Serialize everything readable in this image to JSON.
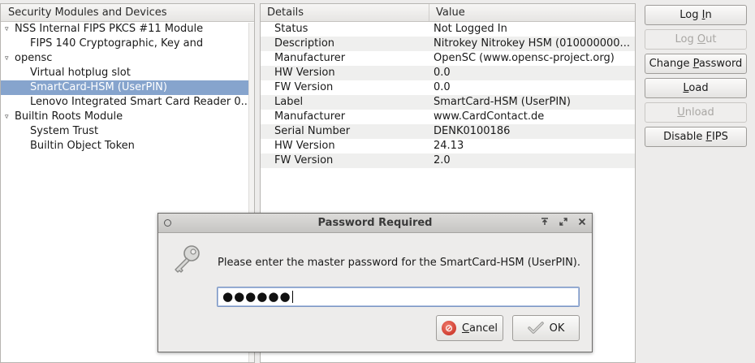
{
  "tree": {
    "header": "Security Modules and Devices",
    "items": [
      {
        "label": "NSS Internal FIPS PKCS #11 Module",
        "expander": "▿"
      },
      {
        "label": "FIPS 140 Cryptographic, Key and"
      },
      {
        "label": "opensc",
        "expander": "▿"
      },
      {
        "label": "Virtual hotplug slot"
      },
      {
        "label": "SmartCard-HSM (UserPIN)"
      },
      {
        "label": "Lenovo Integrated Smart Card Reader 0..."
      },
      {
        "label": "Builtin Roots Module",
        "expander": "▿"
      },
      {
        "label": "System Trust"
      },
      {
        "label": "Builtin Object Token"
      }
    ]
  },
  "details": {
    "col_details": "Details",
    "col_value": "Value",
    "rows": [
      {
        "key": "Status",
        "value": "Not Logged In"
      },
      {
        "key": "Description",
        "value": "Nitrokey Nitrokey HSM (010000000..."
      },
      {
        "key": "Manufacturer",
        "value": "OpenSC (www.opensc-project.org)"
      },
      {
        "key": "HW Version",
        "value": "0.0"
      },
      {
        "key": "FW Version",
        "value": "0.0"
      },
      {
        "key": "Label",
        "value": "SmartCard-HSM (UserPIN)"
      },
      {
        "key": "Manufacturer",
        "value": "www.CardContact.de"
      },
      {
        "key": "Serial Number",
        "value": "DENK0100186"
      },
      {
        "key": "HW Version",
        "value": "24.13"
      },
      {
        "key": "FW Version",
        "value": "2.0"
      }
    ]
  },
  "buttons": {
    "login_pre": "Log ",
    "login_mn": "I",
    "login_post": "n",
    "logout_pre": "Log ",
    "logout_mn": "O",
    "logout_post": "ut",
    "changepw_pre": "Change ",
    "changepw_mn": "P",
    "changepw_post": "assword",
    "load_mn": "L",
    "load_post": "oad",
    "unload_mn": "U",
    "unload_post": "nload",
    "fips_pre": "Disable ",
    "fips_mn": "F",
    "fips_post": "IPS"
  },
  "dialog": {
    "title": "Password Required",
    "message": "Please enter the master password for the SmartCard-HSM (UserPIN).",
    "password_masked": "●●●●●●",
    "cancel_pre": "",
    "cancel_mn": "C",
    "cancel_post": "ancel",
    "ok_label": "OK",
    "icons": {
      "window": "window-menu-icon",
      "keep_above": "keep-above-icon",
      "maximize": "maximize-icon",
      "close": "close-icon",
      "key": "key-icon"
    }
  },
  "colors": {
    "selection": "#86a4cd",
    "focus_border": "#7b96c4",
    "cancel_red": "#c2261b"
  }
}
